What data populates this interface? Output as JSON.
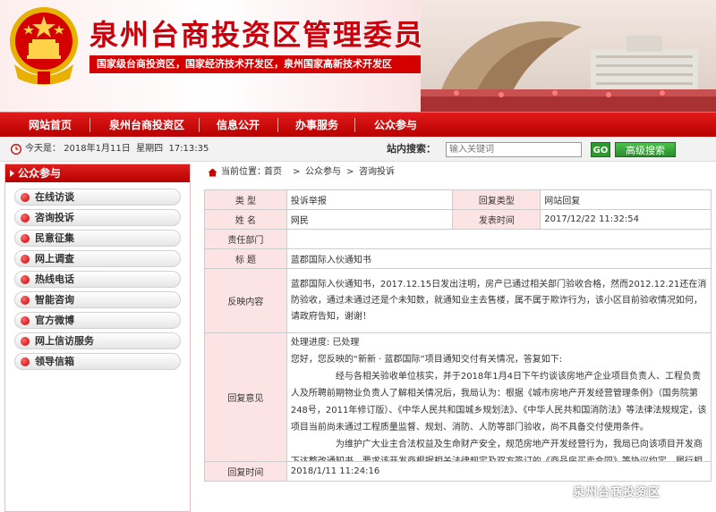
{
  "header": {
    "site_title": "泉州台商投资区管理委员会",
    "subtitle": "国家级台商投资区，国家经济技术开发区，泉州国家高新技术开发区"
  },
  "nav": {
    "items": [
      "网站首页",
      "泉州台商投资区",
      "信息公开",
      "办事服务",
      "公众参与"
    ]
  },
  "infobar": {
    "today_label": "今天是：",
    "date": "2018年1月11日",
    "weekday": "星期四",
    "time": "17:13:35",
    "search_label": "站内搜索：",
    "search_placeholder": "输入关键词",
    "go_label": "GO",
    "advanced_label": "高级搜索"
  },
  "sidebar": {
    "title": "公众参与",
    "items": [
      "在线访谈",
      "咨询投诉",
      "民意征集",
      "网上调查",
      "热线电话",
      "智能咨询",
      "官方微博",
      "网上信访服务",
      "领导信箱"
    ]
  },
  "breadcrumb": {
    "prefix": "当前位置：",
    "sep": ">",
    "items": [
      "首页",
      "公众参与",
      "咨询投诉"
    ]
  },
  "detail": {
    "type_label": "类    型",
    "type_value": "投诉举报",
    "reply_type_label": "回复类型",
    "reply_type_value": "网站回复",
    "name_label": "姓    名",
    "name_value": "网民",
    "publish_time_label": "发表时间",
    "publish_time_value": "2017/12/22 11:32:54",
    "dept_label": "责任部门",
    "dept_value": "",
    "title_label": "标    题",
    "title_value": "蓝郡国际入伙通知书",
    "content_label": "反映内容",
    "content_value": "蓝郡国际入伙通知书，2017.12.15日发出注明，房产已通过相关部门验收合格，然而2012.12.21还在消防验收，通过未通过还是个未知数，就通知业主去售楼，属不属于欺诈行为，该小区目前验收情况如何，请政府告知，谢谢！",
    "reply_label": "回复意见",
    "reply_status": "处理进度: 已处理",
    "reply_p1": "您好，您反映的“新新 · 蓝郡国际”项目通知交付有关情况，答复如下:",
    "reply_p2": "经与各相关验收单位核实，并于2018年1月4日下午约谈该房地产企业项目负责人、工程负责人及所聘前期物业负责人了解相关情况后，我局认为：根据《城市房地产开发经营管理条例》（国务院第248号，2011年修订版）、《中华人民共和国城乡规划法》、《中华人民共和国消防法》等法律法规规定，该项目当前尚未通过工程质量监督、规划、消防、人防等部门验收，尚不具备交付使用条件。",
    "reply_p3": "为维护广大业主合法权益及生命财产安全，规范房地产开发经营行为，我局已向该项目开发商下达整改通知书，要求该开发商根据相关法律规定及双方签订的《商品房买卖合同》等协议约定，履行相应责任义务，认真整改到位。我局也将于近期联合工商、物价等部门对各房地产企业开展检查……",
    "reply_time_label": "回复时间",
    "reply_time_value": "2018/1/11 11:24:16"
  },
  "watermark": "泉州台商投资区",
  "colors": {
    "brand_red": "#c8000b",
    "nav_red": "#d40000",
    "label_bg": "#fde4e4",
    "button_green": "#2e9a2e"
  }
}
